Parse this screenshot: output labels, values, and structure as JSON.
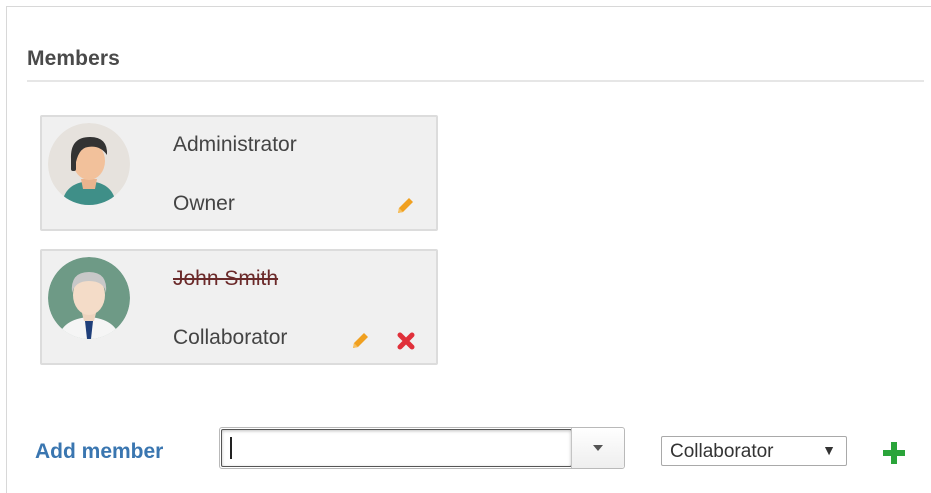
{
  "section": {
    "title": "Members"
  },
  "members": [
    {
      "name": "Administrator",
      "role": "Owner",
      "removed": false
    },
    {
      "name": "John Smith",
      "role": "Collaborator",
      "removed": true
    }
  ],
  "icons": {
    "edit": "pencil-icon",
    "remove": "close-x-icon",
    "add": "plus-icon",
    "dropdown": "chevron-down-icon"
  },
  "add_member": {
    "label": "Add member",
    "input_value": "",
    "role_value": "Collaborator",
    "role_arrow": "▼"
  },
  "colors": {
    "accent_link": "#3a76b0",
    "edit_icon": "#f0a020",
    "remove_icon": "#e0303a",
    "add_icon": "#2aa43a",
    "card_bg": "#f0f0f0"
  }
}
